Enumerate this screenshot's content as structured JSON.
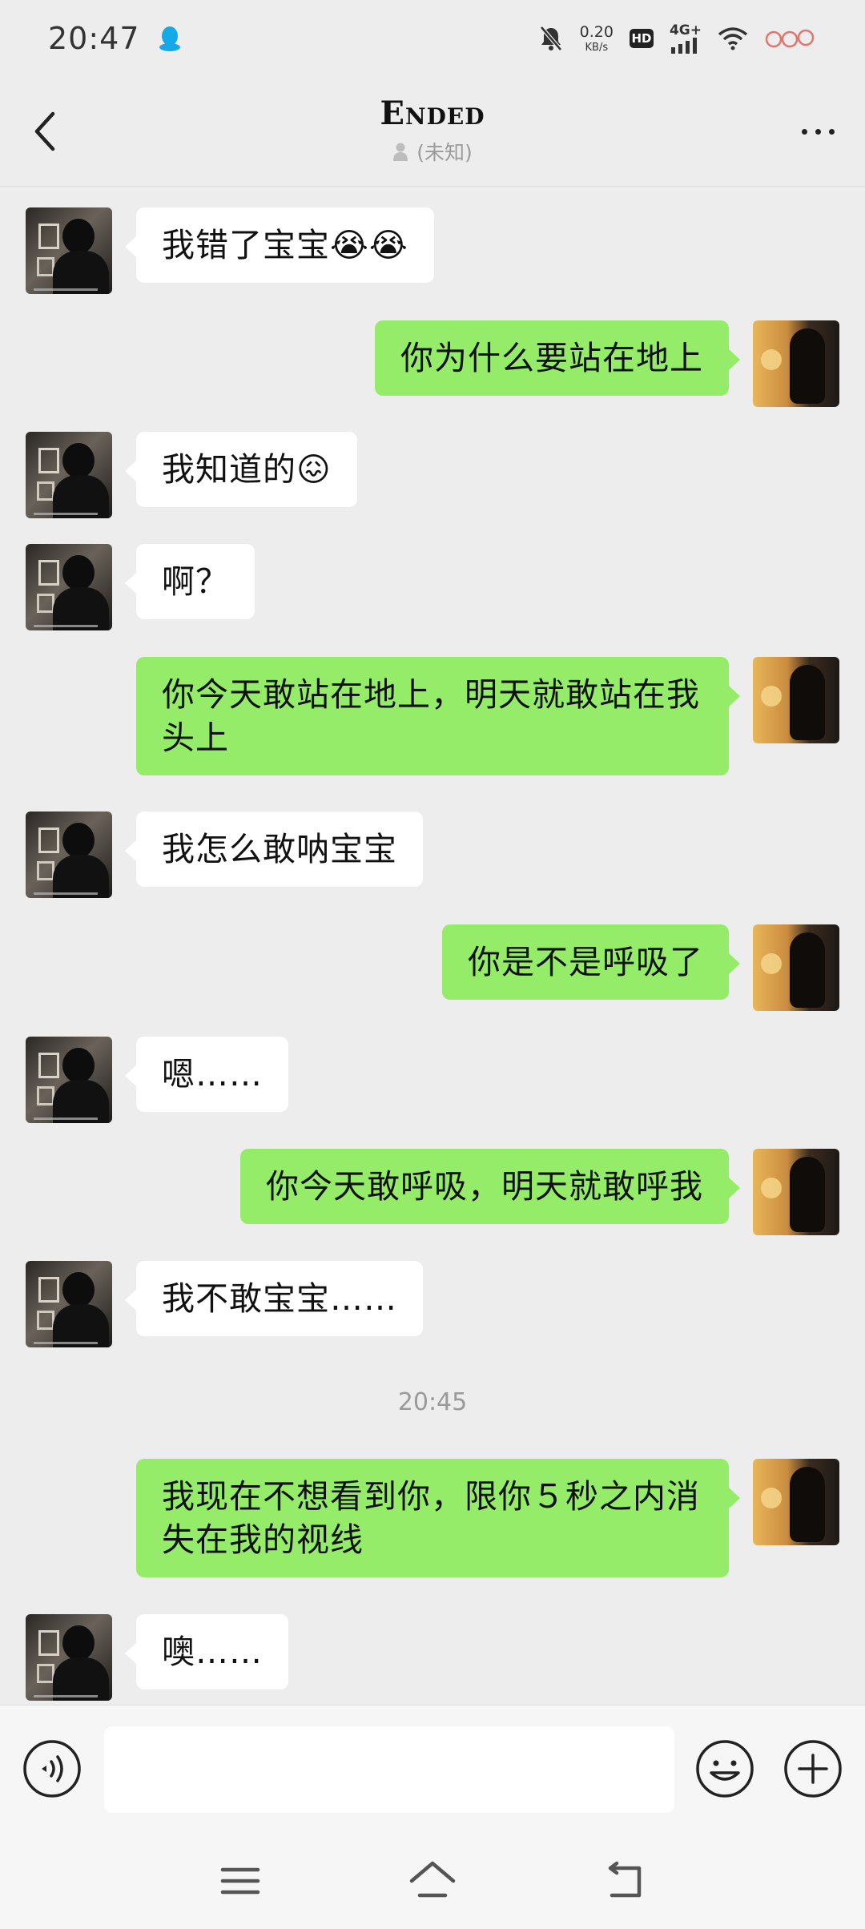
{
  "status_bar": {
    "time": "20:47",
    "net_speed_value": "0.20",
    "net_speed_unit": "KB/s",
    "hd": "HD",
    "network": "4G+",
    "icons": [
      "qq-icon",
      "mute-icon",
      "hd-icon",
      "signal-icon",
      "wifi-icon",
      "sticker-icon"
    ]
  },
  "header": {
    "title": "Ended",
    "subtitle": "(未知)"
  },
  "messages": [
    {
      "side": "in",
      "text": "我错了宝宝😭😭"
    },
    {
      "side": "out",
      "text": "你为什么要站在地上"
    },
    {
      "side": "in",
      "text": "我知道的😖"
    },
    {
      "side": "in",
      "text": "啊？"
    },
    {
      "side": "out",
      "text": "你今天敢站在地上，明天就敢站在我头上"
    },
    {
      "side": "in",
      "text": "我怎么敢呐宝宝"
    },
    {
      "side": "out",
      "text": "你是不是呼吸了"
    },
    {
      "side": "in",
      "text": "嗯……"
    },
    {
      "side": "out",
      "text": "你今天敢呼吸，明天就敢呼我"
    },
    {
      "side": "in",
      "text": "我不敢宝宝……"
    },
    {
      "side": "out",
      "text": "我现在不想看到你，限你５秒之内消失在我的视线"
    },
    {
      "side": "in",
      "text": "噢……"
    }
  ],
  "timestamp": "20:45",
  "input": {
    "value": "",
    "placeholder": ""
  },
  "colors": {
    "outgoing_bubble": "#95ec69",
    "incoming_bubble": "#ffffff",
    "background": "#ededed"
  }
}
